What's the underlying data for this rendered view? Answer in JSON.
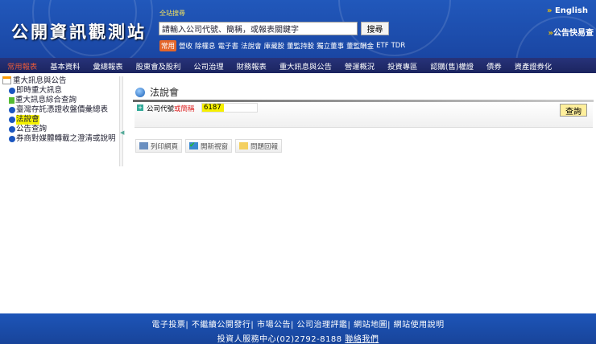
{
  "header": {
    "logo": "公開資訊觀測站",
    "search_label": "全站搜尋",
    "search_placeholder": "請輸入公司代號、簡稱，或報表關鍵字",
    "search_button": "搜尋",
    "quick_tag": "常用",
    "quick_links": [
      "營收",
      "除權息",
      "電子書",
      "法說會",
      "庫藏股",
      "董監持股",
      "獨立董事",
      "董監酬金",
      "ETF",
      "TDR"
    ],
    "english": "English",
    "quick_lookup": "公告快易查"
  },
  "nav": [
    "常用報表",
    "基本資料",
    "彙總報表",
    "股東會及股利",
    "公司治理",
    "財務報表",
    "重大訊息與公告",
    "營運概況",
    "投資專區",
    "認購(售)權證",
    "債券",
    "資產證券化"
  ],
  "sidebar": {
    "root": "重大訊息與公告",
    "items": [
      "即時重大訊息",
      "重大訊息綜合查詢",
      "臺灣存託憑證收盤價彙總表",
      "法說會",
      "公告查詢",
      "券商對媒體轉載之澄清或說明"
    ]
  },
  "main": {
    "title": "法說會",
    "field_label": "公司代號",
    "field_label_or": "或簡稱",
    "field_value": "6187",
    "query_button": "查詢",
    "tools": [
      "列印網頁",
      "開新視窗",
      "問題回報"
    ]
  },
  "footer": {
    "links": "電子投票| 不繼續公開發行| 市場公告| 公司治理評鑑| 網站地圖| 網站使用說明",
    "service": "投資人服務中心(02)2792-8188",
    "contact": "聯絡我們"
  }
}
